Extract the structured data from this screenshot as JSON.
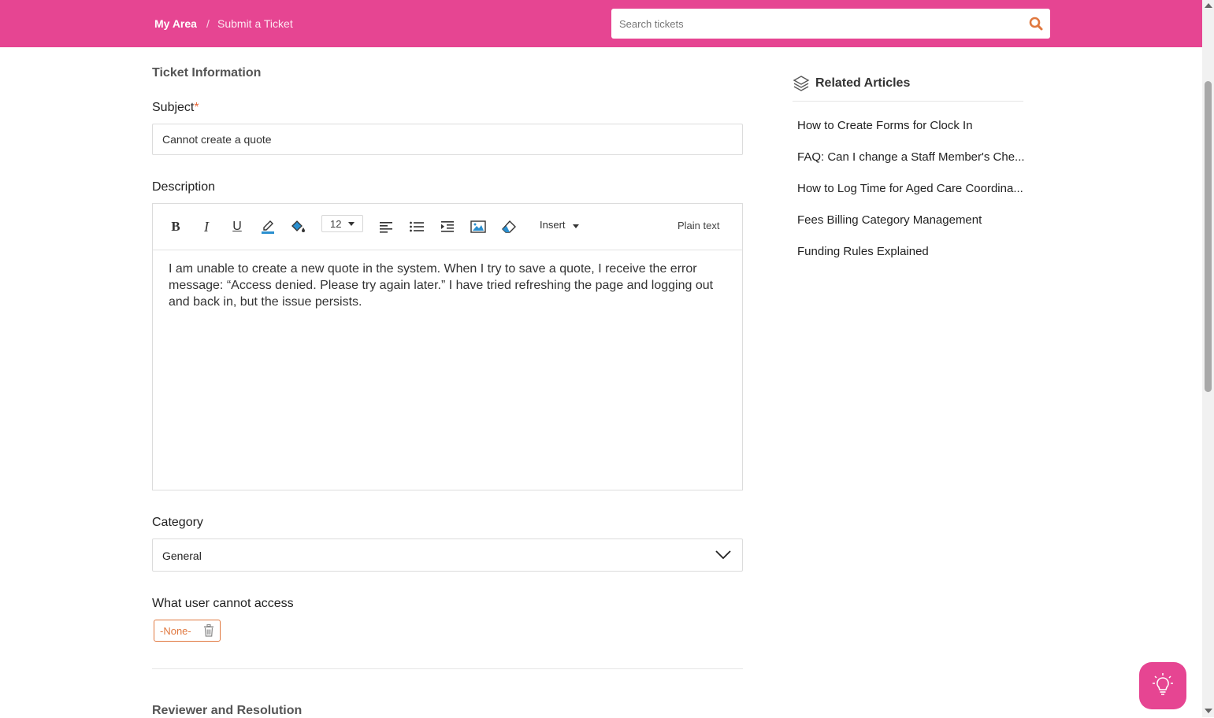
{
  "header": {
    "breadcrumb": {
      "home": "My Area",
      "separator": "/",
      "current": "Submit a Ticket"
    },
    "search": {
      "placeholder": "Search tickets",
      "value": ""
    }
  },
  "form": {
    "section_title": "Ticket Information",
    "subject": {
      "label": "Subject",
      "required_mark": "*",
      "value": "Cannot create a quote"
    },
    "description": {
      "label": "Description",
      "toolbar": {
        "font_size": "12",
        "insert_label": "Insert",
        "plain_text_label": "Plain text"
      },
      "body": "I am unable to create a new quote in the system. When I try to save a quote, I receive the error message: “Access denied. Please try again later.” I have tried refreshing the page and logging out and back in, but the issue persists."
    },
    "category": {
      "label": "Category",
      "value": "General"
    },
    "cannot_access": {
      "label": "What user cannot access",
      "chip": "-None-"
    },
    "next_section_title": "Reviewer and Resolution"
  },
  "related": {
    "title": "Related Articles",
    "articles": [
      "How to Create Forms for Clock In",
      "FAQ: Can I change a Staff Member's Che...",
      "How to Log Time for Aged Care Coordina...",
      "Fees Billing Category Management",
      "Funding Rules Explained"
    ]
  },
  "colors": {
    "brand": "#e64592",
    "accent_orange": "#e0783f",
    "editor_icon_blue": "#2a8fcf"
  },
  "icons": {
    "search": "search-icon",
    "related": "layers-icon",
    "help": "lightbulb-icon",
    "delete": "trash-icon"
  }
}
